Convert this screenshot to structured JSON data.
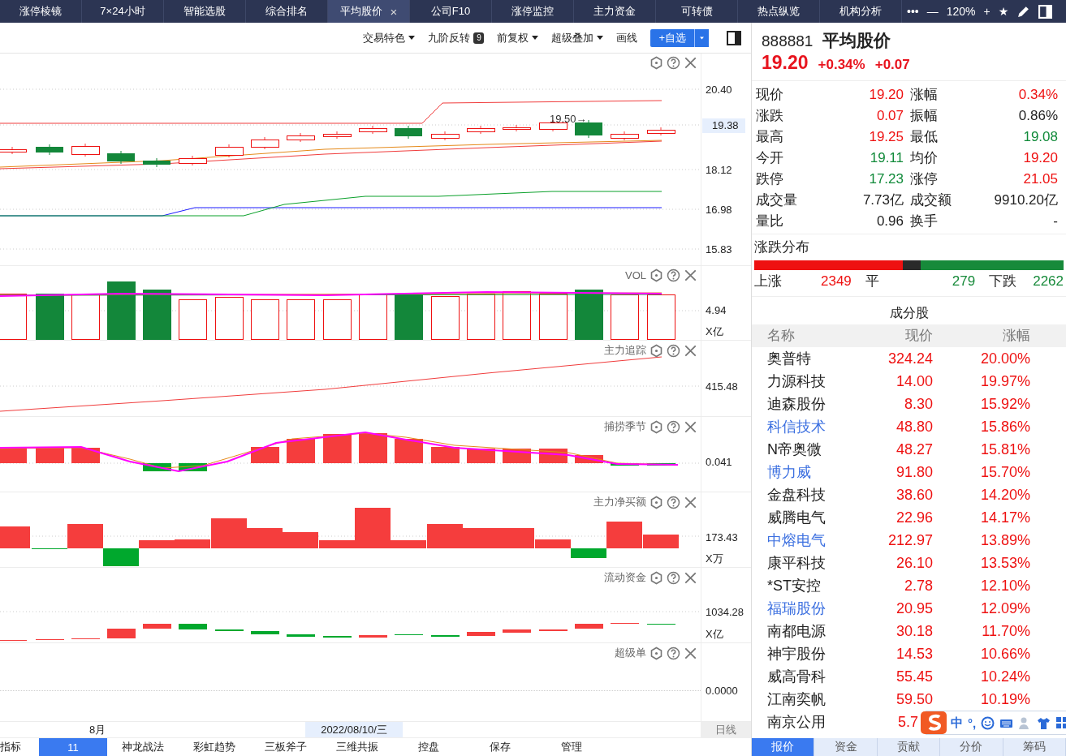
{
  "tabs": [
    {
      "label": "涨停棱镜",
      "selected": false
    },
    {
      "label": "7×24小时",
      "selected": false
    },
    {
      "label": "智能选股",
      "selected": false
    },
    {
      "label": "综合排名",
      "selected": false
    },
    {
      "label": "平均股价",
      "selected": true,
      "close": "×"
    },
    {
      "label": "公司F10",
      "selected": false
    },
    {
      "label": "涨停监控",
      "selected": false
    },
    {
      "label": "主力资金",
      "selected": false
    },
    {
      "label": "可转债",
      "selected": false
    },
    {
      "label": "热点纵览",
      "selected": false
    },
    {
      "label": "机构分析",
      "selected": false
    }
  ],
  "window_tools": [
    "•••",
    "—",
    "120%",
    "+",
    "★"
  ],
  "toolbar": [
    {
      "label": "交易特色",
      "kind": "dropdown"
    },
    {
      "label": "九阶反转",
      "kind": "badge",
      "badge": "9"
    },
    {
      "label": "前复权",
      "kind": "dropdown"
    },
    {
      "label": "超级叠加",
      "kind": "dropdown"
    },
    {
      "label": "画线",
      "kind": "plain"
    },
    {
      "label": "+自选",
      "kind": "split"
    }
  ],
  "panes": [
    {
      "kind": "price",
      "annotation": "19.50→",
      "axis": [
        {
          "label": "20.40",
          "highlight": false
        },
        {
          "label": "19.38",
          "highlight": true
        },
        {
          "label": "18.12",
          "highlight": false
        },
        {
          "label": "16.98",
          "highlight": false
        },
        {
          "label": "15.83",
          "highlight": false
        }
      ]
    },
    {
      "kind": "vol",
      "title": "VOL",
      "axis": [
        {
          "label": "4.94",
          "highlight": false
        },
        {
          "label": "X亿",
          "highlight": false
        }
      ]
    },
    {
      "kind": "track",
      "title": "主力追踪",
      "axis": [
        {
          "label": "415.48",
          "highlight": false
        }
      ]
    },
    {
      "kind": "season",
      "title": "捕捞季节",
      "axis": [
        {
          "label": "0.041",
          "highlight": false
        }
      ]
    },
    {
      "kind": "netbuy",
      "title": "主力净买额",
      "axis": [
        {
          "label": "173.43",
          "highlight": false
        },
        {
          "label": "X万",
          "highlight": false
        }
      ]
    },
    {
      "kind": "flow",
      "title": "流动资金",
      "axis": [
        {
          "label": "1034.28",
          "highlight": false
        },
        {
          "label": "X亿",
          "highlight": false
        }
      ]
    },
    {
      "kind": "super",
      "title": "超级单",
      "axis": [
        {
          "label": "0.0000",
          "highlight": false
        }
      ]
    }
  ],
  "date_axis": {
    "month": "8月",
    "cursor_date": "2022/08/10/三",
    "period": "日线"
  },
  "bottom_tabs": [
    {
      "label": "指标",
      "selected": false
    },
    {
      "label": "11",
      "selected": true
    },
    {
      "label": "神龙战法",
      "selected": false
    },
    {
      "label": "彩虹趋势",
      "selected": false
    },
    {
      "label": "三板斧子",
      "selected": false
    },
    {
      "label": "三维共振",
      "selected": false
    },
    {
      "label": "控盘",
      "selected": false
    },
    {
      "label": "保存",
      "selected": false
    },
    {
      "label": "管理",
      "selected": false
    }
  ],
  "quote": {
    "code": "888881",
    "name": "平均股价",
    "price": "19.20",
    "change_pct": "+0.34%",
    "change": "+0.07"
  },
  "stats": [
    {
      "label": "现价",
      "value": "19.20",
      "color": "#ee1111"
    },
    {
      "label": "涨幅",
      "value": "0.34%",
      "color": "#ee1111"
    },
    {
      "label": "涨跌",
      "value": "0.07",
      "color": "#ee1111"
    },
    {
      "label": "振幅",
      "value": "0.86%",
      "color": "#222222"
    },
    {
      "label": "最高",
      "value": "19.25",
      "color": "#ee1111"
    },
    {
      "label": "最低",
      "value": "19.08",
      "color": "#118a3a"
    },
    {
      "label": "今开",
      "value": "19.11",
      "color": "#118a3a"
    },
    {
      "label": "均价",
      "value": "19.20",
      "color": "#ee1111"
    },
    {
      "label": "跌停",
      "value": "17.23",
      "color": "#118a3a"
    },
    {
      "label": "涨停",
      "value": "21.05",
      "color": "#ee1111"
    },
    {
      "label": "成交量",
      "value": "7.73亿",
      "color": "#222222"
    },
    {
      "label": "成交额",
      "value": "9910.20亿",
      "color": "#222222"
    },
    {
      "label": "量比",
      "value": "0.96",
      "color": "#222222"
    },
    {
      "label": "换手",
      "value": "-",
      "color": "#222222"
    }
  ],
  "distribution": {
    "title": "涨跌分布",
    "segments": [
      {
        "label": "上涨",
        "count": "2349",
        "color": "#ee1111"
      },
      {
        "label": "平",
        "count": "279",
        "color": "#2a2a2a"
      },
      {
        "label": "下跌",
        "count": "2262",
        "color": "#178a3a"
      }
    ]
  },
  "constituents": {
    "title": "成分股",
    "columns": [
      "名称",
      "现价",
      "涨幅"
    ],
    "rows": [
      {
        "name": "奥普特",
        "price": "324.24",
        "pct": "20.00%",
        "linked": false
      },
      {
        "name": "力源科技",
        "price": "14.00",
        "pct": "19.97%",
        "linked": false
      },
      {
        "name": "迪森股份",
        "price": "8.30",
        "pct": "15.92%",
        "linked": false
      },
      {
        "name": "科信技术",
        "price": "48.80",
        "pct": "15.86%",
        "linked": true
      },
      {
        "name": "N帝奥微",
        "price": "48.27",
        "pct": "15.81%",
        "linked": false
      },
      {
        "name": "博力威",
        "price": "91.80",
        "pct": "15.70%",
        "linked": true
      },
      {
        "name": "金盘科技",
        "price": "38.60",
        "pct": "14.20%",
        "linked": false
      },
      {
        "name": "威腾电气",
        "price": "22.96",
        "pct": "14.17%",
        "linked": false
      },
      {
        "name": "中熔电气",
        "price": "212.97",
        "pct": "13.89%",
        "linked": true
      },
      {
        "name": "康平科技",
        "price": "26.10",
        "pct": "13.53%",
        "linked": false
      },
      {
        "name": "*ST安控",
        "price": "2.78",
        "pct": "12.10%",
        "linked": false
      },
      {
        "name": "福瑞股份",
        "price": "20.95",
        "pct": "12.09%",
        "linked": true
      },
      {
        "name": "南都电源",
        "price": "30.18",
        "pct": "11.70%",
        "linked": false
      },
      {
        "name": "神宇股份",
        "price": "14.53",
        "pct": "10.66%",
        "linked": false
      },
      {
        "name": "威高骨科",
        "price": "55.45",
        "pct": "10.24%",
        "linked": false
      },
      {
        "name": "江南奕帆",
        "price": "59.50",
        "pct": "10.19%",
        "linked": false
      },
      {
        "name": "南京公用",
        "price": "5.7",
        "linked": false
      }
    ]
  },
  "ime_bar": {
    "mode": "中",
    "punct": "°,"
  },
  "panel_tabs": [
    {
      "label": "报价",
      "selected": true
    },
    {
      "label": "资金",
      "selected": false
    },
    {
      "label": "贡献",
      "selected": false
    },
    {
      "label": "分价",
      "selected": false
    },
    {
      "label": "筹码",
      "selected": false
    }
  ]
}
